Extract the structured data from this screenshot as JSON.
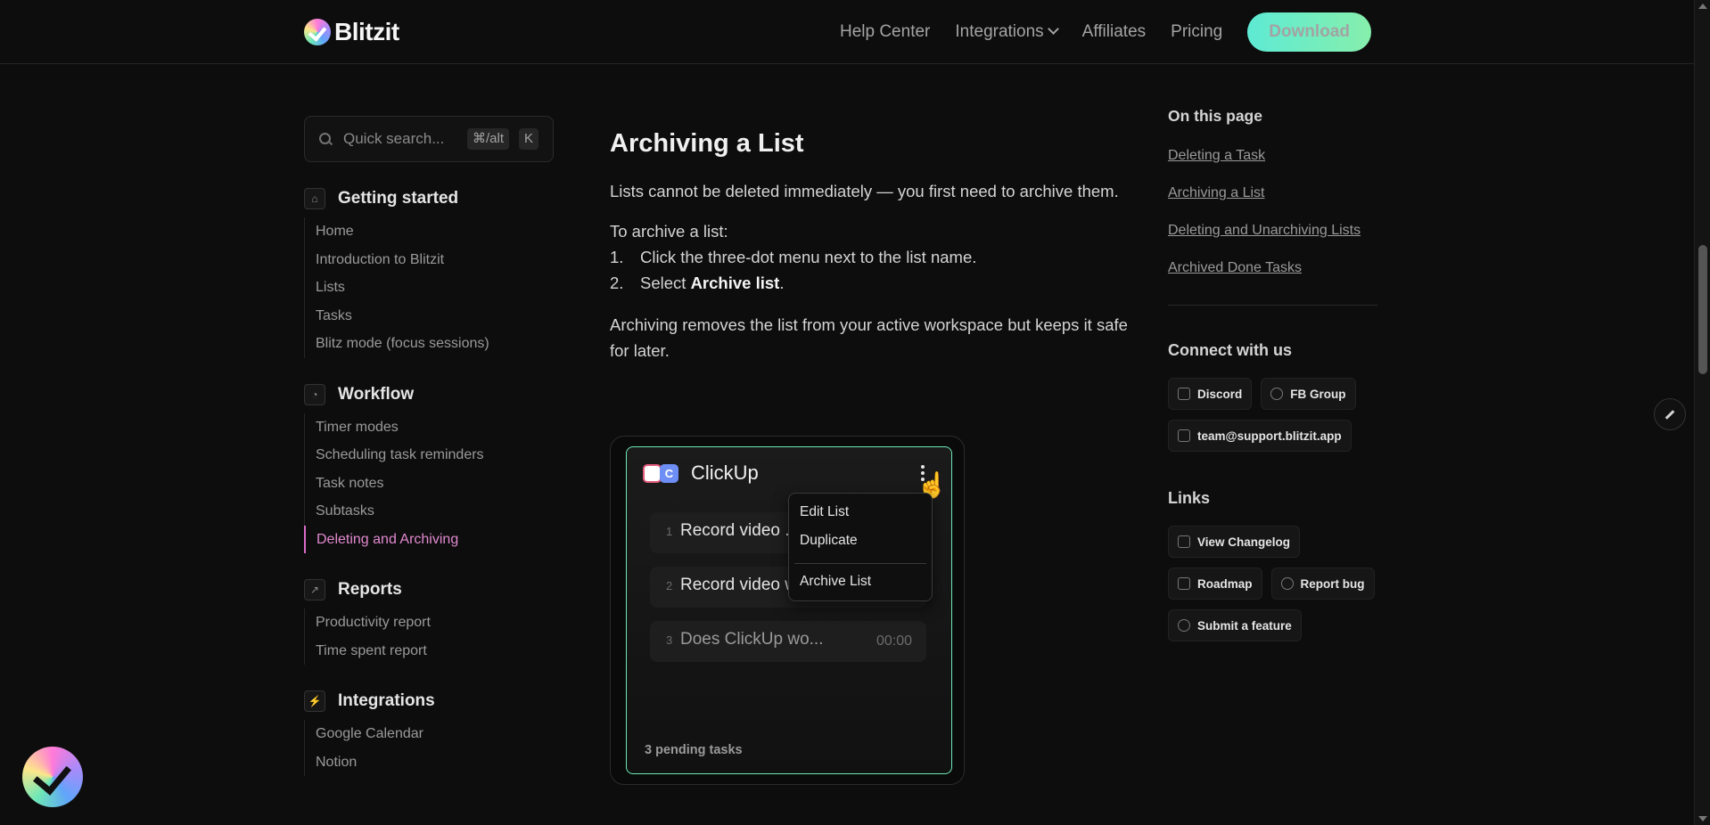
{
  "header": {
    "brand": "Blitzit",
    "nav": [
      "Help Center",
      "Integrations",
      "Affiliates",
      "Pricing"
    ],
    "download_label": "Download"
  },
  "sidebar": {
    "search": {
      "placeholder": "Quick search...",
      "shortcut_mod": "⌘/alt",
      "shortcut_key": "K"
    },
    "sections": [
      {
        "title": "Getting started",
        "icon": "home-icon",
        "items": [
          "Home",
          "Introduction to Blitzit",
          "Lists",
          "Tasks",
          "Blitz mode (focus sessions)"
        ]
      },
      {
        "title": "Workflow",
        "icon": "timer-icon",
        "items": [
          "Timer modes",
          "Scheduling task reminders",
          "Task notes",
          "Subtasks",
          "Deleting and Archiving"
        ],
        "active": "Deleting and Archiving"
      },
      {
        "title": "Reports",
        "icon": "chart-icon",
        "items": [
          "Productivity report",
          "Time spent report"
        ]
      },
      {
        "title": "Integrations",
        "icon": "plug-icon",
        "items": [
          "Google Calendar",
          "Notion"
        ]
      }
    ]
  },
  "article": {
    "heading": "Archiving a List",
    "intro": "Lists cannot be deleted immediately — you first need to archive them.",
    "steps_intro": "To archive a list:",
    "steps": [
      {
        "num": "1.",
        "text": "Click the three-dot menu next to the list name."
      },
      {
        "num": "2.",
        "prefix": "Select ",
        "bold": "Archive list",
        "suffix": "."
      }
    ],
    "outro": "Archiving removes the list from your active workspace but keeps it safe for later."
  },
  "demo": {
    "app_badge": "C",
    "title": "ClickUp",
    "tasks": [
      {
        "num": "1",
        "text": "Record video ..."
      },
      {
        "num": "2",
        "text": "Record video w"
      },
      {
        "num": "3",
        "text": "Does ClickUp wo...",
        "time": "00:00"
      }
    ],
    "menu": [
      "Edit List",
      "Duplicate",
      "Archive List"
    ],
    "footer": "3 pending tasks"
  },
  "toc": {
    "heading": "On this page",
    "links": [
      "Deleting a Task",
      "Archiving a List",
      "Deleting and Unarchiving Lists",
      "Archived Done Tasks"
    ]
  },
  "connect": {
    "heading": "Connect with us",
    "items": [
      {
        "label": "Discord",
        "icon": "discord-icon"
      },
      {
        "label": "FB Group",
        "icon": "facebook-icon"
      },
      {
        "label": "team@support.blitzit.app",
        "icon": "mail-icon"
      }
    ]
  },
  "links": {
    "heading": "Links",
    "items": [
      {
        "label": "View Changelog",
        "icon": "changelog-icon"
      },
      {
        "label": "Roadmap",
        "icon": "map-icon"
      },
      {
        "label": "Report bug",
        "icon": "bug-icon"
      },
      {
        "label": "Submit a feature",
        "icon": "lightbulb-icon"
      }
    ]
  },
  "colors": {
    "accent_active": "#e28ad0",
    "download_gradient_start": "#5eead4",
    "download_gradient_end": "#86efac",
    "card_border": "#6ee7b7"
  }
}
